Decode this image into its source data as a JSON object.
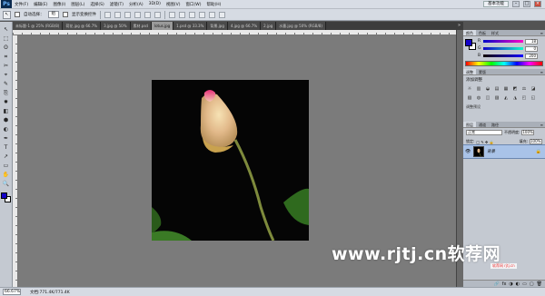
{
  "app": {
    "logo": "Ps"
  },
  "menubar": {
    "items": [
      "文件(F)",
      "编辑(E)",
      "图像(I)",
      "图层(L)",
      "选择(S)",
      "滤镜(T)",
      "分析(A)",
      "3D(D)",
      "视图(V)",
      "窗口(W)",
      "帮助(H)"
    ],
    "workspace": "基本功能",
    "minimize": "–",
    "restore": "□",
    "close": "×"
  },
  "options": {
    "auto_select_label": "自动选择：",
    "auto_select_value": "组",
    "show_transform_label": "显示变换控件"
  },
  "tabs": [
    {
      "label": "未标题-1 @ 25% (RGB/8)"
    },
    {
      "label": "荷花.jpg @ 66.7%"
    },
    {
      "label": "3.jpg @ 50%"
    },
    {
      "label": "素材.psd"
    },
    {
      "label": "lotus.jpg"
    },
    {
      "label": "1.psd @ 33.3%"
    },
    {
      "label": "背景.jpg"
    },
    {
      "label": "4.jpg @ 66.7%"
    },
    {
      "label": "2.jpg"
    },
    {
      "label": "水墨.jpg @ 50% (RGB/8)"
    }
  ],
  "tabs_more": "»",
  "tools": [
    "↖",
    "⬚",
    "ʘ",
    "⌗",
    "✂",
    "⌖",
    "✎",
    "⎘",
    "✹",
    "◧",
    "⬢",
    "◐",
    "✒",
    "T",
    "↗",
    "▭",
    "✋",
    "🔍"
  ],
  "status": {
    "zoom": "66.67%",
    "doc": "文档:771.4K/771.4K"
  },
  "color_panel": {
    "tabs": [
      "颜色",
      "色板",
      "样式"
    ],
    "rows": [
      {
        "label": "R",
        "value": "18"
      },
      {
        "label": "G",
        "value": "0"
      },
      {
        "label": "B",
        "value": "200"
      }
    ],
    "fg_color": "#1200c8"
  },
  "adjust_panel": {
    "tabs": [
      "调整",
      "蒙版"
    ],
    "title": "添加调整",
    "icons": [
      "☼",
      "▥",
      "◒",
      "▤",
      "▦",
      "◩",
      "⚖",
      "◪",
      "▧",
      "◍",
      "◫",
      "▨",
      "◭",
      "◮",
      "◰",
      "◱"
    ],
    "footer": "调整预设"
  },
  "layers_panel": {
    "tabs": [
      "图层",
      "通道",
      "路径"
    ],
    "blend_mode": "正常",
    "opacity_label": "不透明度:",
    "opacity": "100%",
    "lock_label": "锁定:",
    "fill_label": "填充:",
    "fill": "100%",
    "layer_name": "背景",
    "footer_icons": [
      "🔗",
      "fx",
      "◑",
      "◐",
      "▭",
      "▢",
      "🗑"
    ]
  },
  "watermark": {
    "text": "www.rjtj.cn软荐网",
    "sub": "软荐网 rjtj.cn"
  }
}
